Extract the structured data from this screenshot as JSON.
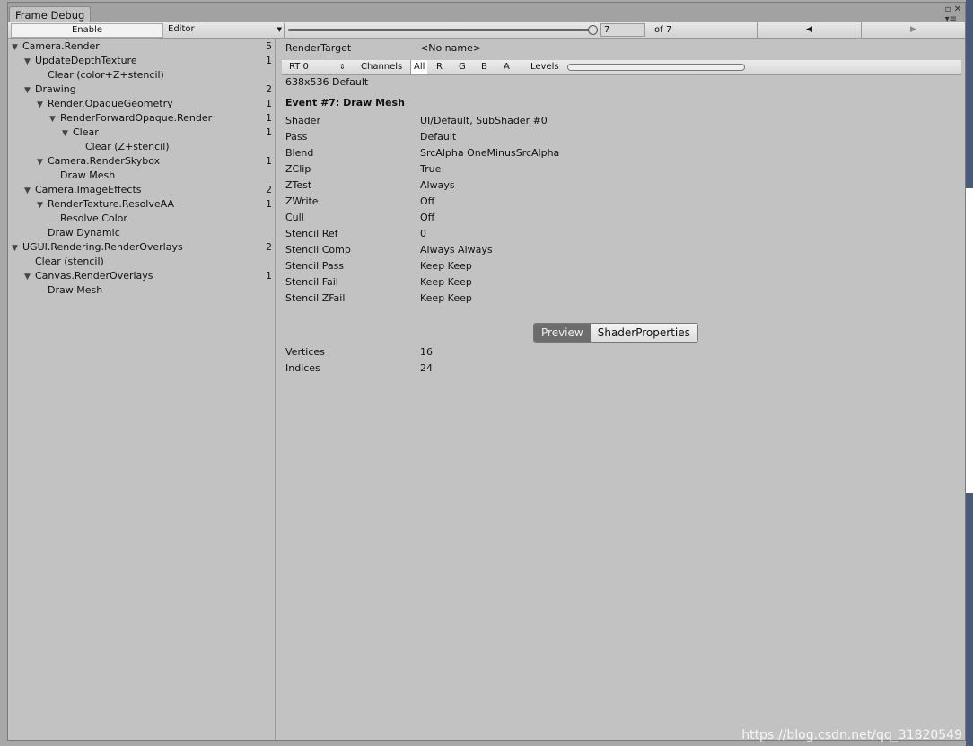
{
  "window": {
    "title": "Frame Debug"
  },
  "toolbar": {
    "enable_label": "Enable",
    "target_label": "Editor",
    "event_index": "7",
    "event_total": "of 7",
    "prev_icon": "triangle-left-icon",
    "next_icon": "triangle-right-icon",
    "slider_fraction": 1.0
  },
  "tree": [
    {
      "label": "Camera.Render",
      "depth": 0,
      "expanded": true,
      "count": "5"
    },
    {
      "label": "UpdateDepthTexture",
      "depth": 1,
      "expanded": true,
      "count": "1"
    },
    {
      "label": "Clear (color+Z+stencil)",
      "depth": 2,
      "count": ""
    },
    {
      "label": "Drawing",
      "depth": 1,
      "expanded": true,
      "count": "2"
    },
    {
      "label": "Render.OpaqueGeometry",
      "depth": 2,
      "expanded": true,
      "count": "1"
    },
    {
      "label": "RenderForwardOpaque.Render",
      "depth": 3,
      "expanded": true,
      "count": "1"
    },
    {
      "label": "Clear",
      "depth": 4,
      "expanded": true,
      "count": "1"
    },
    {
      "label": "Clear (Z+stencil)",
      "depth": 5,
      "count": ""
    },
    {
      "label": "Camera.RenderSkybox",
      "depth": 2,
      "expanded": true,
      "count": "1"
    },
    {
      "label": "Draw Mesh",
      "depth": 3,
      "count": ""
    },
    {
      "label": "Camera.ImageEffects",
      "depth": 1,
      "expanded": true,
      "count": "2"
    },
    {
      "label": "RenderTexture.ResolveAA",
      "depth": 2,
      "expanded": true,
      "count": "1"
    },
    {
      "label": "Resolve Color",
      "depth": 3,
      "count": ""
    },
    {
      "label": "Draw Dynamic",
      "depth": 2,
      "count": ""
    },
    {
      "label": "UGUI.Rendering.RenderOverlays",
      "depth": 0,
      "expanded": true,
      "count": "2"
    },
    {
      "label": "Clear (stencil)",
      "depth": 1,
      "count": ""
    },
    {
      "label": "Canvas.RenderOverlays",
      "depth": 1,
      "expanded": true,
      "count": "1"
    },
    {
      "label": "Draw Mesh",
      "depth": 2,
      "count": ""
    }
  ],
  "detail": {
    "render_target_label": "RenderTarget",
    "render_target_value": "<No name>",
    "rt_select": "RT 0",
    "channels_label": "Channels",
    "channels": [
      "All",
      "R",
      "G",
      "B",
      "A"
    ],
    "channel_selected": "All",
    "levels_label": "Levels",
    "resolution": "638x536 Default",
    "event_title": "Event #7: Draw Mesh",
    "props": [
      {
        "k": "Shader",
        "v": "UI/Default, SubShader #0"
      },
      {
        "k": "Pass",
        "v": "Default"
      },
      {
        "k": "Blend",
        "v": "SrcAlpha OneMinusSrcAlpha"
      },
      {
        "k": "ZClip",
        "v": "True"
      },
      {
        "k": "ZTest",
        "v": "Always"
      },
      {
        "k": "ZWrite",
        "v": "Off"
      },
      {
        "k": "Cull",
        "v": "Off"
      },
      {
        "k": "Stencil Ref",
        "v": "0"
      },
      {
        "k": "Stencil Comp",
        "v": "Always Always"
      },
      {
        "k": "Stencil Pass",
        "v": "Keep Keep"
      },
      {
        "k": "Stencil Fail",
        "v": "Keep Keep"
      },
      {
        "k": "Stencil ZFail",
        "v": "Keep Keep"
      }
    ],
    "tabs": [
      "Preview",
      "ShaderProperties"
    ],
    "tab_selected": "Preview",
    "stats": [
      {
        "k": "Vertices",
        "v": "16"
      },
      {
        "k": "Indices",
        "v": "24"
      }
    ]
  },
  "watermark": "https://blog.csdn.net/qq_31820549"
}
